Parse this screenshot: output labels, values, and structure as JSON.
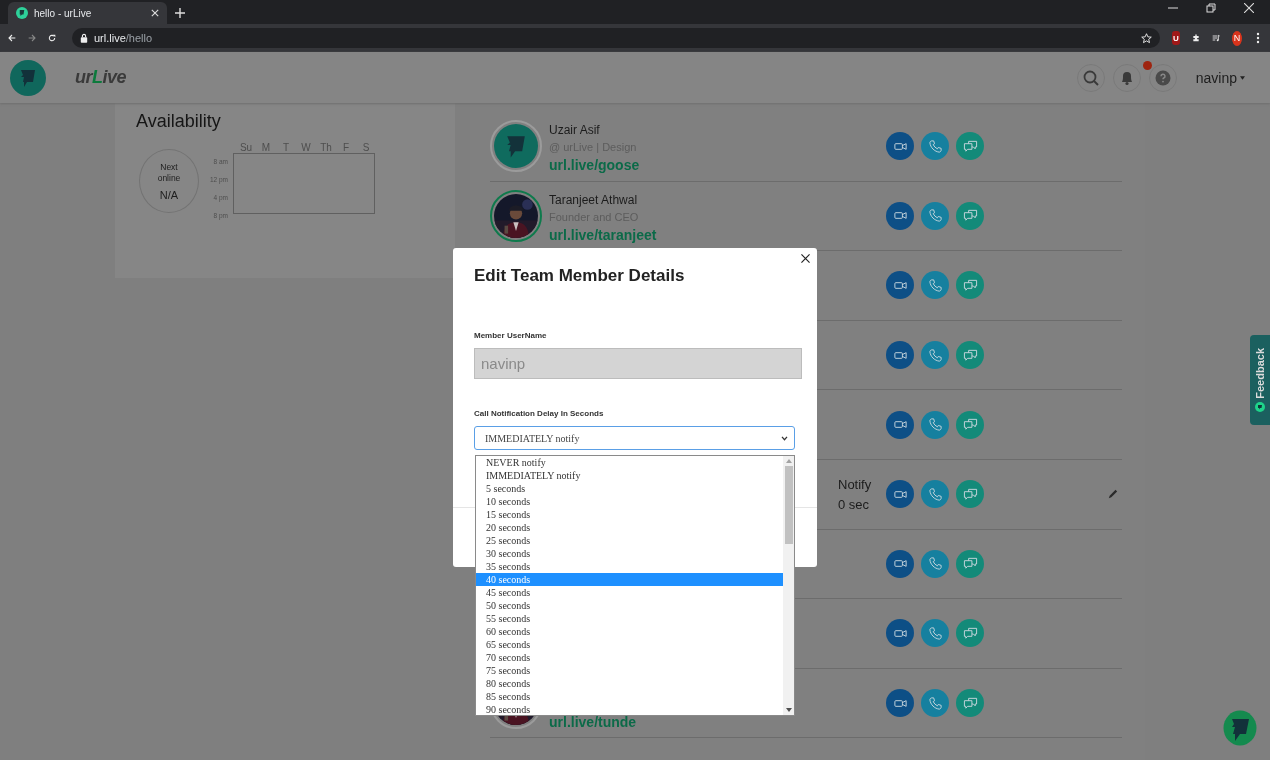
{
  "browser": {
    "tab_title": "hello - urLive",
    "url_host": "url.live",
    "url_path": "/hello",
    "extension_label": "U",
    "profile_initial": "N"
  },
  "header": {
    "brand": [
      {
        "text": "ur",
        "accent": false
      },
      {
        "text": "L",
        "accent": true
      },
      {
        "text": "ive",
        "accent": false
      }
    ],
    "unread_notifications": true,
    "user": "navinp"
  },
  "availability": {
    "title": "Availability",
    "next_online_label": "Next online",
    "next_online_value": "N/A",
    "days": [
      "Su",
      "M",
      "T",
      "W",
      "Th",
      "F",
      "S"
    ],
    "times": [
      "8 am",
      "12 pm",
      "4 pm",
      "8 pm"
    ]
  },
  "members": [
    {
      "avatar": {
        "kind": "logo"
      },
      "online": false,
      "name": "Uzair Asif",
      "subtitle": "@ urLive | Design",
      "link": "url.live/goose",
      "editable": false
    },
    {
      "online": true,
      "name": "Taranjeet Athwal",
      "subtitle": "Founder and CEO",
      "link": "url.live/taranjeet",
      "editable": false
    },
    {
      "editable": false
    },
    {
      "editable": false
    },
    {
      "editable": false
    },
    {
      "notify_label": "Notify",
      "notify_value": "0 sec",
      "editable": true
    },
    {
      "editable": false
    },
    {
      "editable": false
    },
    {
      "online": false,
      "link": "url.live/tunde",
      "editable": false
    }
  ],
  "modal": {
    "title": "Edit Team Member Details",
    "username_label": "Member UserName",
    "username_value": "navinp",
    "delay_label": "Call Notification Delay In Seconds",
    "delay_value": "IMMEDIATELY notify",
    "options": [
      {
        "label": "NEVER notify",
        "selected": false
      },
      {
        "label": "IMMEDIATELY notify",
        "selected": false
      },
      {
        "label": "5 seconds",
        "selected": false
      },
      {
        "label": "10 seconds",
        "selected": false
      },
      {
        "label": "15 seconds",
        "selected": false
      },
      {
        "label": "20 seconds",
        "selected": false
      },
      {
        "label": "25 seconds",
        "selected": false
      },
      {
        "label": "30 seconds",
        "selected": false
      },
      {
        "label": "35 seconds",
        "selected": false
      },
      {
        "label": "40 seconds",
        "selected": true
      },
      {
        "label": "45 seconds",
        "selected": false
      },
      {
        "label": "50 seconds",
        "selected": false
      },
      {
        "label": "55 seconds",
        "selected": false
      },
      {
        "label": "60 seconds",
        "selected": false
      },
      {
        "label": "65 seconds",
        "selected": false
      },
      {
        "label": "70 seconds",
        "selected": false
      },
      {
        "label": "75 seconds",
        "selected": false
      },
      {
        "label": "80 seconds",
        "selected": false
      },
      {
        "label": "85 seconds",
        "selected": false
      },
      {
        "label": "90 seconds",
        "selected": false
      }
    ]
  },
  "feedback_tab": {
    "label": "Feedback"
  }
}
